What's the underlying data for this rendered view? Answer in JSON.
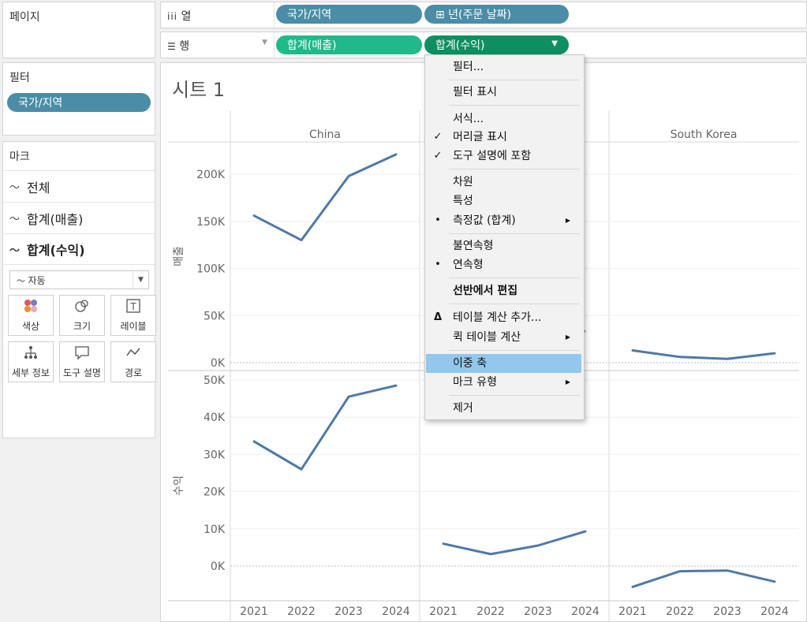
{
  "pages_panel": {
    "title": "페이지"
  },
  "filters_panel": {
    "title": "필터",
    "pill": "국가/지역"
  },
  "marks_panel": {
    "title": "마크",
    "rows": [
      "전체",
      "합계(매출)",
      "합계(수익)"
    ],
    "mark_type": "자동",
    "buttons": [
      "색상",
      "크기",
      "레이블",
      "세부 정보",
      "도구 설명",
      "경로"
    ]
  },
  "columns_shelf": {
    "label": "열",
    "pills": [
      "국가/지역",
      "⊞ 년(주문 날짜)"
    ]
  },
  "rows_shelf": {
    "label": "행",
    "pills": [
      "합계(매출)",
      "합계(수익)"
    ]
  },
  "sheet": {
    "title": "시트 1"
  },
  "context_menu": {
    "items": [
      {
        "label": "필터...",
        "mark": "",
        "arrow": false
      },
      {
        "label": "필터 표시",
        "mark": "",
        "arrow": false
      },
      {
        "label": "서식...",
        "mark": "",
        "arrow": false
      },
      {
        "label": "머리글 표시",
        "mark": "✓",
        "arrow": false
      },
      {
        "label": "도구 설명에 포함",
        "mark": "✓",
        "arrow": false
      },
      {
        "label": "차원",
        "mark": "",
        "arrow": false
      },
      {
        "label": "특성",
        "mark": "",
        "arrow": false
      },
      {
        "label": "측정값 (합계)",
        "mark": "•",
        "arrow": true
      },
      {
        "label": "불연속형",
        "mark": "",
        "arrow": false
      },
      {
        "label": "연속형",
        "mark": "•",
        "arrow": false
      },
      {
        "label": "선반에서 편집",
        "mark": "",
        "arrow": false
      },
      {
        "label": "테이블 계산 추가...",
        "mark": "Δ",
        "arrow": false
      },
      {
        "label": "퀵 테이블 계산",
        "mark": "",
        "arrow": true
      },
      {
        "label": "이중 축",
        "mark": "",
        "arrow": false
      },
      {
        "label": "마크 유형",
        "mark": "",
        "arrow": true
      },
      {
        "label": "제거",
        "mark": "",
        "arrow": false
      }
    ]
  },
  "colors": {
    "line": "#4e79a7",
    "pill_blue": "#4b8da6",
    "pill_green": "#1fb98a",
    "highlight": "#94c7ee"
  },
  "chart_data": {
    "type": "line",
    "panels": [
      "China",
      "",
      "South Korea"
    ],
    "x": [
      "2021",
      "2022",
      "2023",
      "2024"
    ],
    "rows": [
      {
        "ylabel": "매출",
        "yticks": [
          "200K",
          "150K",
          "100K",
          "50K",
          "0K"
        ],
        "ylim": [
          -5000,
          222000
        ],
        "series": [
          [
            156000,
            130000,
            198000,
            221000
          ],
          [
            null,
            null,
            null,
            33000
          ],
          [
            13000,
            6000,
            4000,
            10000
          ]
        ]
      },
      {
        "ylabel": "수익",
        "yticks": [
          "50K",
          "40K",
          "30K",
          "20K",
          "10K",
          "0K"
        ],
        "ylim": [
          -9000,
          51000
        ],
        "series": [
          [
            33500,
            26000,
            45500,
            48500
          ],
          [
            6000,
            3200,
            5500,
            9300
          ],
          [
            -5600,
            -1400,
            -1200,
            -4200
          ]
        ]
      }
    ]
  }
}
